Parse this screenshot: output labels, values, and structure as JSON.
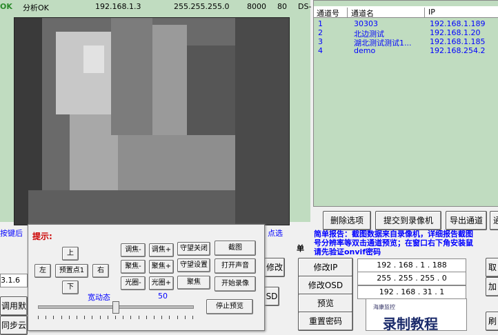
{
  "topbar": {
    "ok": "OK",
    "status": "分析OK",
    "ip": "192.168.1.3",
    "mask": "255.255.255.0",
    "port1": "8000",
    "port2": "80",
    "ds": "DS-"
  },
  "channels": {
    "headers": [
      "通道号",
      "通道名",
      "IP"
    ],
    "rows": [
      {
        "num": "1",
        "name": "30303",
        "ip": "192.168.1.189"
      },
      {
        "num": "2",
        "name": "北边测试",
        "ip": "192.168.1.20"
      },
      {
        "num": "3",
        "name": "湖北测试测试1...",
        "ip": "192.168.1.185"
      },
      {
        "num": "4",
        "name": "demo",
        "ip": "192.168.254.2"
      }
    ]
  },
  "channel_buttons": {
    "delete": "删除选项",
    "submit": "提交到录像机",
    "export": "导出通道",
    "partial": "通"
  },
  "report": {
    "line1": "简单报告：截图数据来自录像机，详细报告截图",
    "line2": "号分辨率等双击通道预览；在窗口右下角安装鼠",
    "line3": "请先验证onvif密码"
  },
  "left_partial": {
    "hint": "按键后",
    "ip_partial": "3.1.6",
    "call_default": "调用默",
    "sync": "同步云",
    "dian_xuan": "点选"
  },
  "dialog": {
    "title": "提示:",
    "up": "上",
    "down": "下",
    "left": "左",
    "right": "右",
    "preset": "预置点1",
    "focus_minus_a": "调焦-",
    "focus_plus_a": "调焦+",
    "guard_close": "守望关闭",
    "snapshot": "截图",
    "zoom_minus": "聚焦-",
    "zoom_plus": "聚焦+",
    "guard_set": "守望设置",
    "open_sound": "打开声音",
    "iris_minus": "光圈-",
    "iris_plus": "光圈+",
    "gather": "聚焦",
    "start_record": "开始录像",
    "wdr_label": "宽动态",
    "wdr_value": "50",
    "stop_preview": "停止预览"
  },
  "right_form": {
    "single_label": "单",
    "modify_ip": "修改IP",
    "modify_osd": "修改OSD",
    "preview": "预览",
    "reset_pwd": "重置密码",
    "modify_partial": "修改",
    "osd_partial": "SD",
    "ip_field": "192 . 168 . 1 . 188",
    "mask_field": "255 . 255 . 255 . 0",
    "gw_field": "192 . 168 . 31 . 1",
    "side1": "取",
    "side2": "加",
    "side3": "刷"
  },
  "preview_box": {
    "brand": "海康监控",
    "title": "录制教程"
  },
  "colors": {
    "green_bg": "#c0dcc0",
    "link_blue": "#0000ff",
    "hint_red": "#cc0000"
  },
  "wdr_level": 0.5
}
